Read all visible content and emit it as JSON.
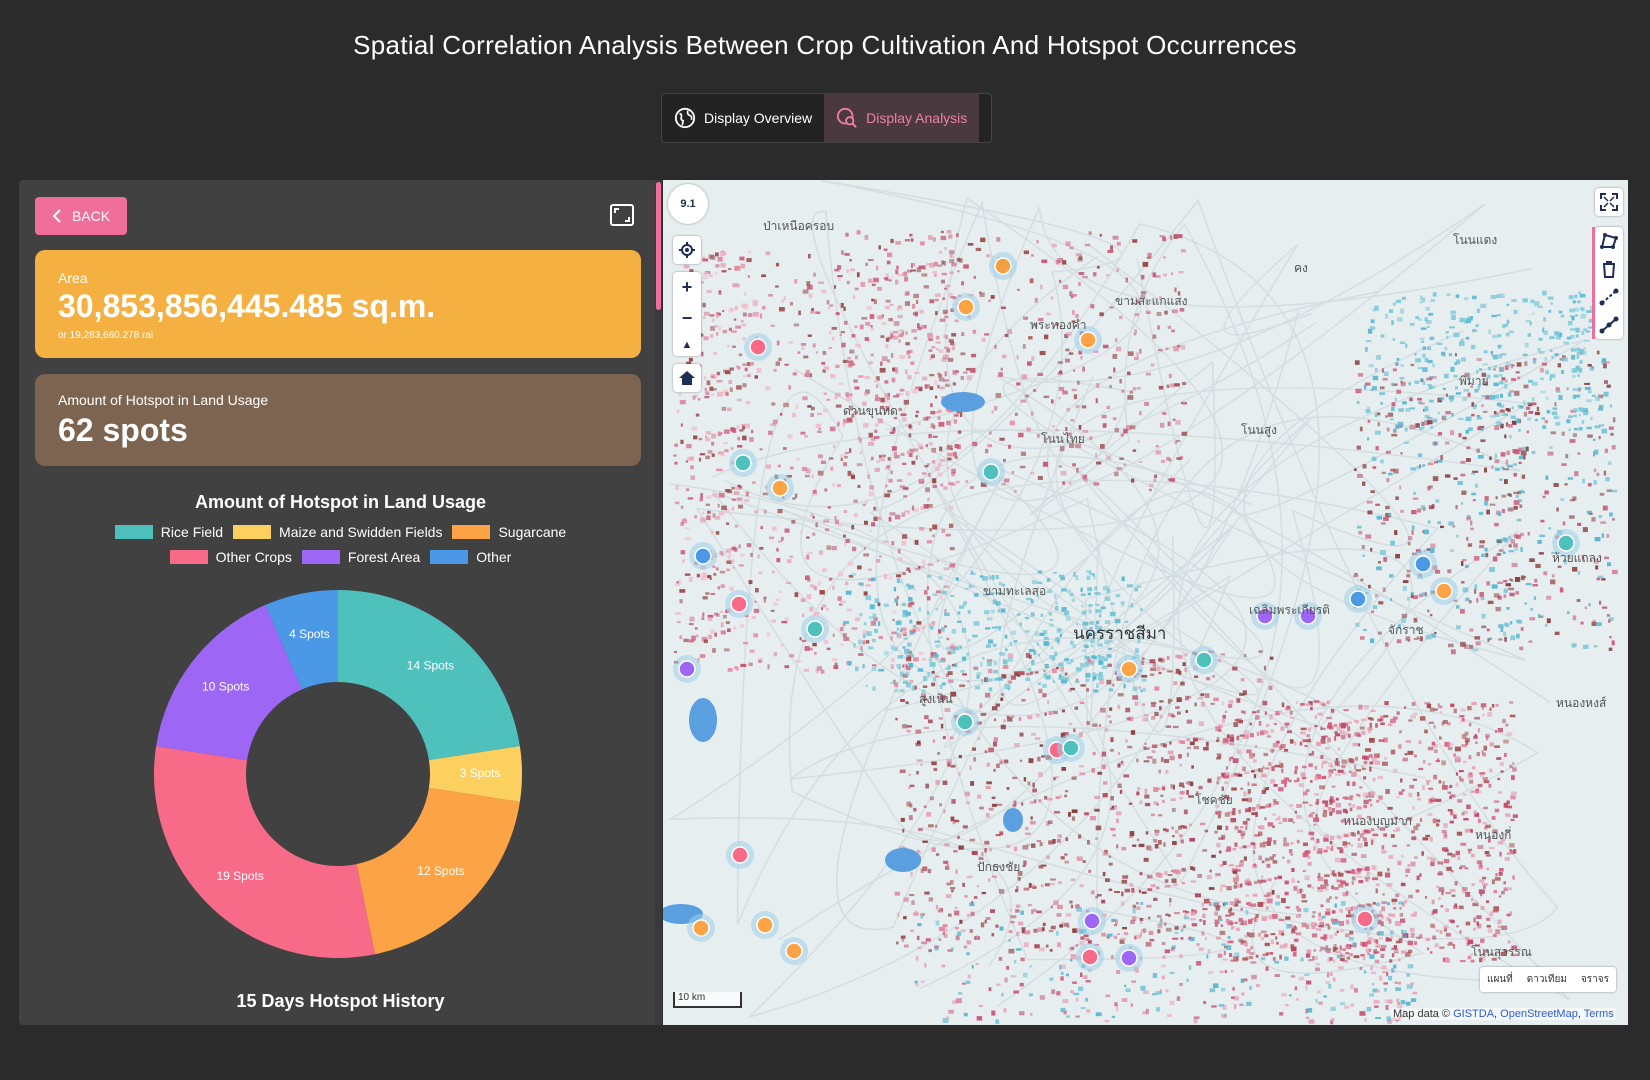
{
  "page": {
    "title": "Spatial Correlation Analysis Between Crop Cultivation And Hotspot Occurrences"
  },
  "view_toggle": {
    "overview_label": "Display Overview",
    "analysis_label": "Display Analysis",
    "active": "analysis"
  },
  "panel": {
    "back_label": "BACK",
    "area": {
      "label": "Area",
      "value": "30,853,856,445.485 sq.m.",
      "sub": "or 19,283,660.278 rai"
    },
    "hotspot": {
      "label": "Amount of Hotspot in Land Usage",
      "value": "62 spots"
    },
    "history_title": "15 Days Hotspot History"
  },
  "colors": {
    "accent": "#f06e9a",
    "area_card": "#f5b042",
    "hotspot_card": "#7c6450"
  },
  "chart_data": {
    "type": "pie",
    "title": "Amount of Hotspot in Land Usage",
    "legend_position": "top",
    "donut": true,
    "slices": [
      {
        "label": "Rice Field",
        "value": 14,
        "data_label": "14 Spots",
        "color": "#4fc1bd"
      },
      {
        "label": "Maize and Swidden Fields",
        "value": 3,
        "data_label": "3 Spots",
        "color": "#fbd05e"
      },
      {
        "label": "Sugarcane",
        "value": 12,
        "data_label": "12 Spots",
        "color": "#fca345"
      },
      {
        "label": "Other Crops",
        "value": 19,
        "data_label": "19 Spots",
        "color": "#f76b89"
      },
      {
        "label": "Forest Area",
        "value": 10,
        "data_label": "10 Spots",
        "color": "#9d66f5"
      },
      {
        "label": "Other",
        "value": 4,
        "data_label": "4 Spots",
        "color": "#4a98e6"
      }
    ]
  },
  "map": {
    "zoom": "9.1",
    "scale_label": "10 km",
    "places": [
      "ป่าเหนือครอบ",
      "โนนแดง",
      "คง",
      "ขามสะแกแสง",
      "พระทองคำ",
      "ด่านขุนทด",
      "โนนสูง",
      "โนนไทย",
      "พิมาย",
      "ห้วยแถลง",
      "เฉลิมพระเกียรติ",
      "นครราชสีมา",
      "จักราช",
      "ขามทะเลสอ",
      "สูงเนิน",
      "หนองหงส์",
      "โชคชัย",
      "หนองบุญมาก",
      "หนองกี่",
      "ปักธงชัย",
      "โนนสุวรรณ"
    ],
    "basemap_options": [
      "แผนที่",
      "ดาวเทียม",
      "จราจร"
    ],
    "attribution": {
      "prefix": "Map data ©",
      "gistda": "GISTDA",
      "osm": "OpenStreetMap",
      "terms": "Terms"
    }
  }
}
